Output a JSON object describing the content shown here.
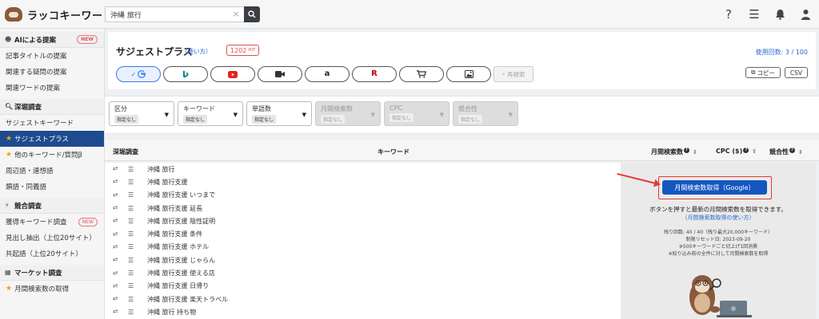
{
  "app": {
    "name": "ラッコキーワード"
  },
  "search": {
    "value": "沖縄 旅行",
    "placeholder": ""
  },
  "header_icons": [
    "help-icon",
    "menu-icon",
    "bell-icon",
    "user-icon"
  ],
  "sidebar": {
    "sections": [
      {
        "title": "AIによる提案",
        "icon": "robot-icon",
        "badge": "NEW",
        "items": [
          "記事タイトルの提案",
          "関連する疑問の提案",
          "関連ワードの提案"
        ]
      },
      {
        "title": "深堀調査",
        "icon": "search-icon",
        "items": [
          "サジェストキーワード",
          "サジェストプラス",
          "他のキーワード/質問β",
          "周辺語・連想語",
          "類語・同義語"
        ]
      },
      {
        "title": "競合調査",
        "icon": "bolt-icon",
        "items": [
          "獲得キーワード調査",
          "見出し抽出（上位20サイト）",
          "共起語（上位20サイト）"
        ],
        "badge_item": "NEW"
      },
      {
        "title": "マーケット調査",
        "icon": "chart-icon",
        "items": [
          "月間検索数の取得"
        ]
      }
    ],
    "active_item": "サジェストプラス"
  },
  "page": {
    "title": "サジェストプラス",
    "howto_link": "（使い方）",
    "hit_count": "1202",
    "hit_unit": "HIT",
    "usage": "使用回数: 3 / 100",
    "copy_label": "コピー",
    "csv_label": "CSV",
    "research_label": "再検索"
  },
  "engines": [
    "google",
    "bing",
    "youtube",
    "video",
    "amazon",
    "rakuten",
    "shopping",
    "images"
  ],
  "filters": [
    {
      "label": "区分",
      "value": "指定なし",
      "disabled": false
    },
    {
      "label": "キーワード",
      "value": "指定なし",
      "disabled": false
    },
    {
      "label": "単語数",
      "value": "指定なし",
      "disabled": false
    },
    {
      "label": "月間検索数",
      "value": "指定なし",
      "disabled": true
    },
    {
      "label": "CPC",
      "value": "指定なし",
      "disabled": true
    },
    {
      "label": "競合性",
      "value": "指定なし",
      "disabled": true
    }
  ],
  "table": {
    "col_deep": "深堀調査",
    "col_keyword": "キーワード",
    "col_volume": "月間検索数",
    "col_cpc": "CPC ($)",
    "col_comp": "競合性",
    "rows": [
      "沖縄 旅行",
      "沖縄 旅行支援",
      "沖縄 旅行支援 いつまで",
      "沖縄 旅行支援 延長",
      "沖縄 旅行支援 陰性証明",
      "沖縄 旅行支援 条件",
      "沖縄 旅行支援 ホテル",
      "沖縄 旅行支援 じゃらん",
      "沖縄 旅行支援 使える店",
      "沖縄 旅行支援 日帰り",
      "沖縄 旅行支援 楽天トラベル",
      "沖縄 旅行 持ち物"
    ]
  },
  "volume_panel": {
    "button": "月間検索数取得（Google）",
    "message": "ボタンを押すと最新の月間検索数を取得できます。",
    "howto": "（月間検索数取得の使い方）",
    "remaining": "残り回数: 40 / 40（残り最大20,000キーワード）",
    "reset": "制限リセット日: 2023-09-20",
    "note1": "※500キーワードごと切上げ1回消費",
    "note2": "※絞り込み前の全件に対して月間検索数を取得"
  },
  "colors": {
    "accent": "#1557c0",
    "active_nav": "#1e4b8f",
    "alert": "#e53935",
    "star": "#f0a500"
  }
}
